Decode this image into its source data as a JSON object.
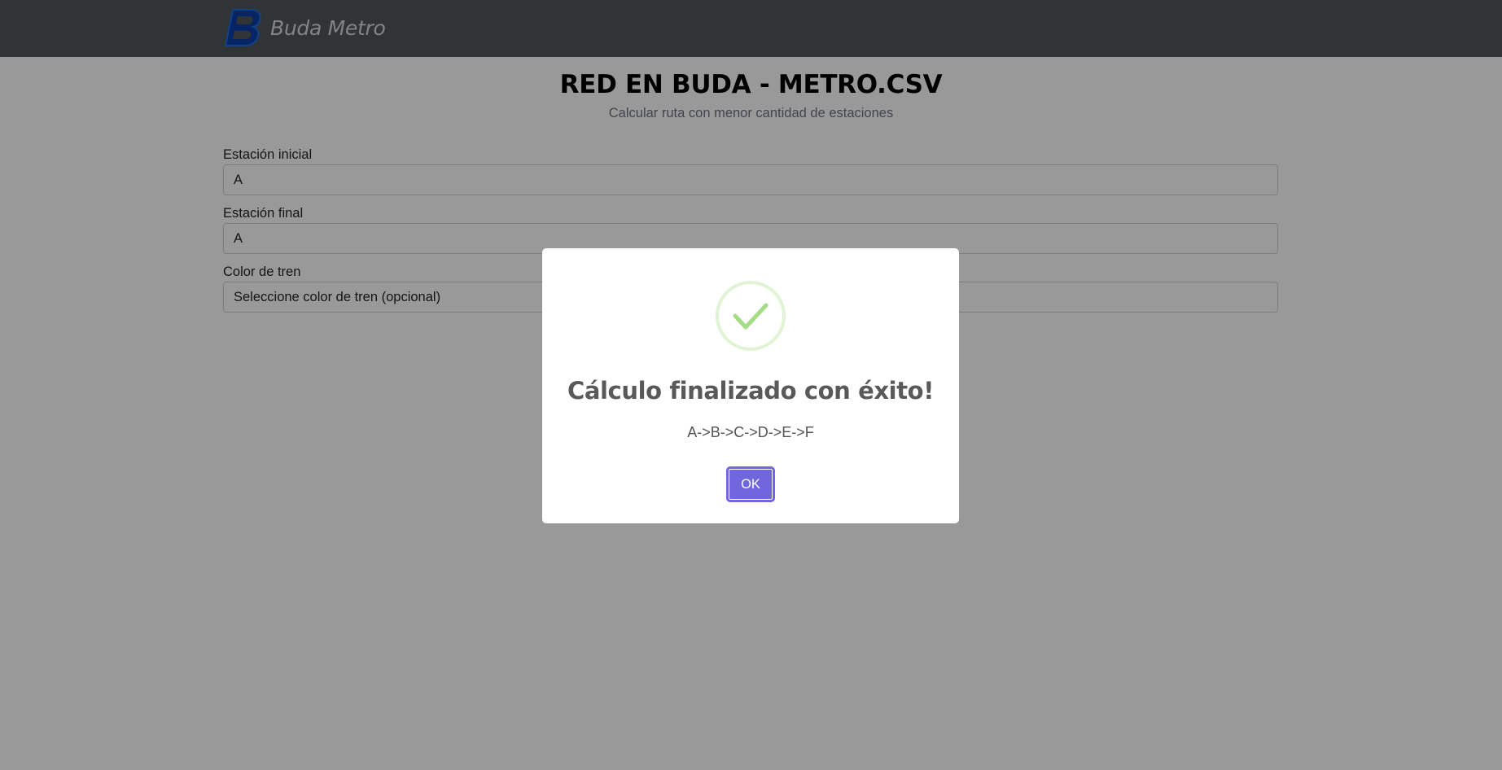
{
  "navbar": {
    "brand_letter": "B",
    "brand_name": "Buda Metro",
    "logo_color": "#0d3fa8"
  },
  "page": {
    "title": "RED EN BUDA - METRO.CSV",
    "subtitle": "Calcular ruta con menor cantidad de estaciones"
  },
  "form": {
    "start_label": "Estación inicial",
    "start_value": "A",
    "end_label": "Estación final",
    "end_value": "A",
    "color_label": "Color de tren",
    "color_value": "Seleccione color de tren (opcional)"
  },
  "modal": {
    "icon": "success-check-icon",
    "icon_color": "#a5dc86",
    "title": "Cálculo finalizado con éxito!",
    "text": "A->B->C->D->E->F",
    "ok_label": "OK",
    "ok_color": "#7066e0"
  }
}
